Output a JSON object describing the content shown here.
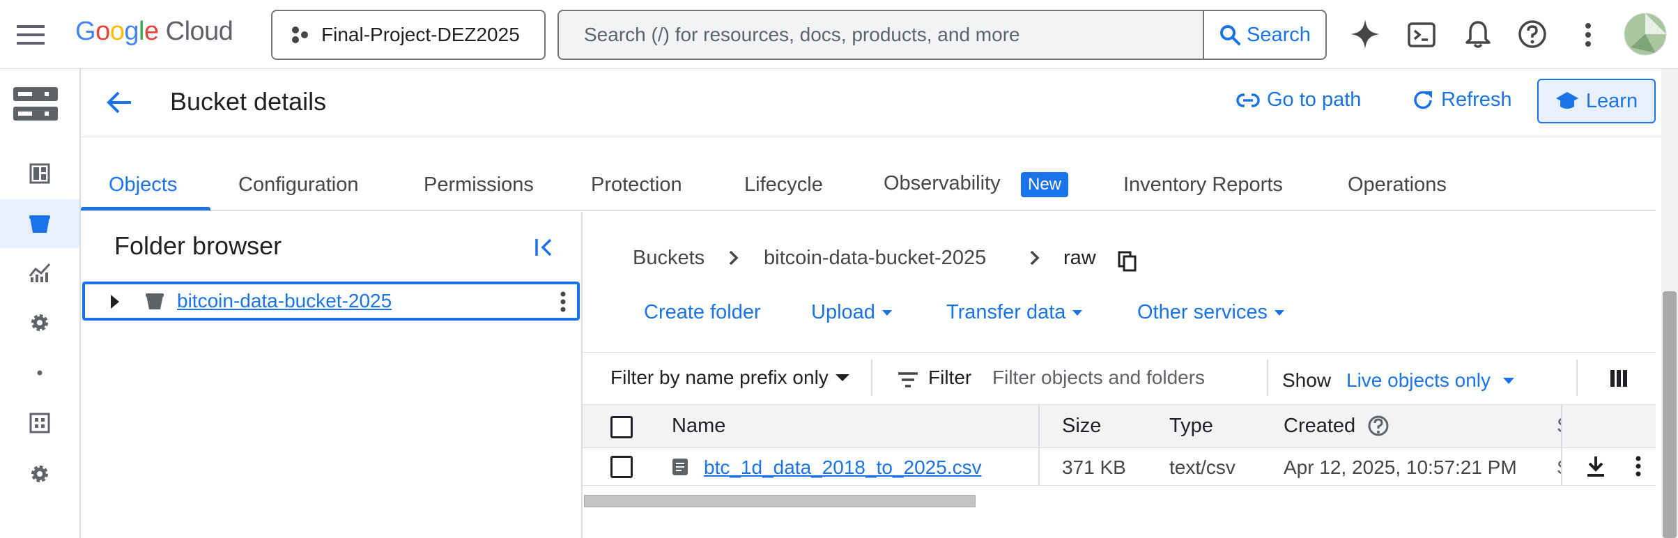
{
  "topbar": {
    "logo_word": "Google",
    "logo_product": "Cloud",
    "project_name": "Final-Project-DEZ2025",
    "search_placeholder": "Search (/) for resources, docs, products, and more",
    "search_button": "Search"
  },
  "header": {
    "title": "Bucket details",
    "go_to_path": "Go to path",
    "refresh": "Refresh",
    "learn": "Learn"
  },
  "tabs": [
    {
      "label": "Objects"
    },
    {
      "label": "Configuration"
    },
    {
      "label": "Permissions"
    },
    {
      "label": "Protection"
    },
    {
      "label": "Lifecycle"
    },
    {
      "label": "Observability"
    },
    {
      "label": "Inventory Reports"
    },
    {
      "label": "Operations"
    }
  ],
  "tab_badge": "New",
  "folder_browser": {
    "title": "Folder browser",
    "bucket": "bitcoin-data-bucket-2025"
  },
  "breadcrumb": {
    "root": "Buckets",
    "bucket": "bitcoin-data-bucket-2025",
    "folder": "raw"
  },
  "actions": {
    "create_folder": "Create folder",
    "upload": "Upload",
    "transfer_data": "Transfer data",
    "other_services": "Other services"
  },
  "filter": {
    "prefix_mode": "Filter by name prefix only",
    "filter_label": "Filter",
    "placeholder": "Filter objects and folders",
    "show_label": "Show",
    "show_value": "Live objects only"
  },
  "table": {
    "headers": {
      "name": "Name",
      "size": "Size",
      "type": "Type",
      "created": "Created",
      "next_col_partial": "S"
    },
    "rows": [
      {
        "name": "btc_1d_data_2018_to_2025.csv",
        "size": "371 KB",
        "type": "text/csv",
        "created": "Apr 12, 2025, 10:57:21 PM",
        "next_col_partial": "S"
      }
    ]
  },
  "colors": {
    "accent": "#1a73e8",
    "active_bg": "#e8f0fe",
    "border": "#dadce0",
    "logo_blue": "#4285f4",
    "logo_red": "#ea4335",
    "logo_yellow": "#fbbc05",
    "logo_green": "#34a853"
  }
}
